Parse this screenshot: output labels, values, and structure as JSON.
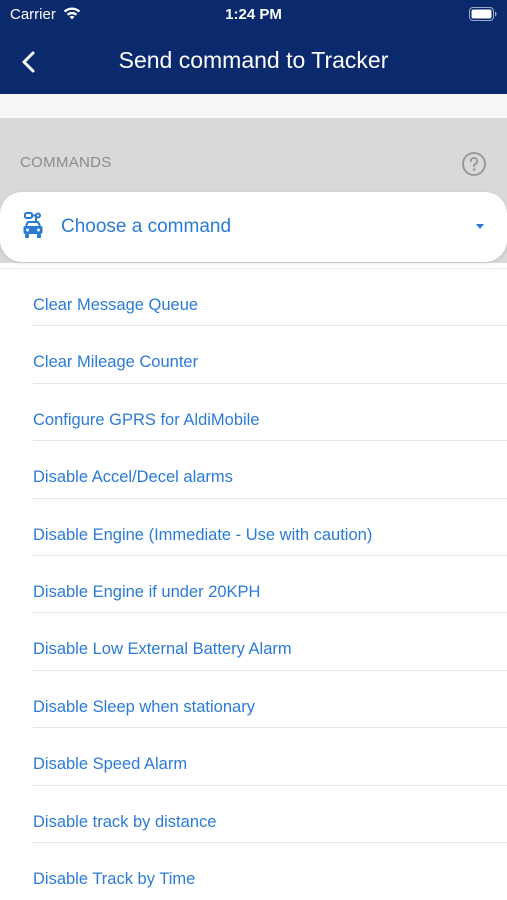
{
  "status_bar": {
    "carrier": "Carrier",
    "time": "1:24 PM",
    "wifi_icon": "wifi-icon",
    "battery_icon": "battery-icon"
  },
  "nav": {
    "title": "Send command to Tracker",
    "back_icon": "chevron-left-icon",
    "background": "#0b2a6e"
  },
  "section": {
    "label": "COMMANDS",
    "help_icon": "help-circle-icon"
  },
  "dropdown": {
    "label": "Choose a command",
    "icon": "car-icon",
    "caret_icon": "caret-down-icon",
    "accent": "#2b7bd6"
  },
  "commands": [
    "Clear Message Queue",
    "Clear Mileage Counter",
    "Configure GPRS for AldiMobile",
    "Disable Accel/Decel alarms",
    "Disable Engine (Immediate - Use with caution)",
    "Disable Engine if under 20KPH",
    "Disable Low External Battery Alarm",
    "Disable Sleep when stationary",
    "Disable Speed Alarm",
    "Disable track by distance",
    "Disable Track by Time"
  ]
}
